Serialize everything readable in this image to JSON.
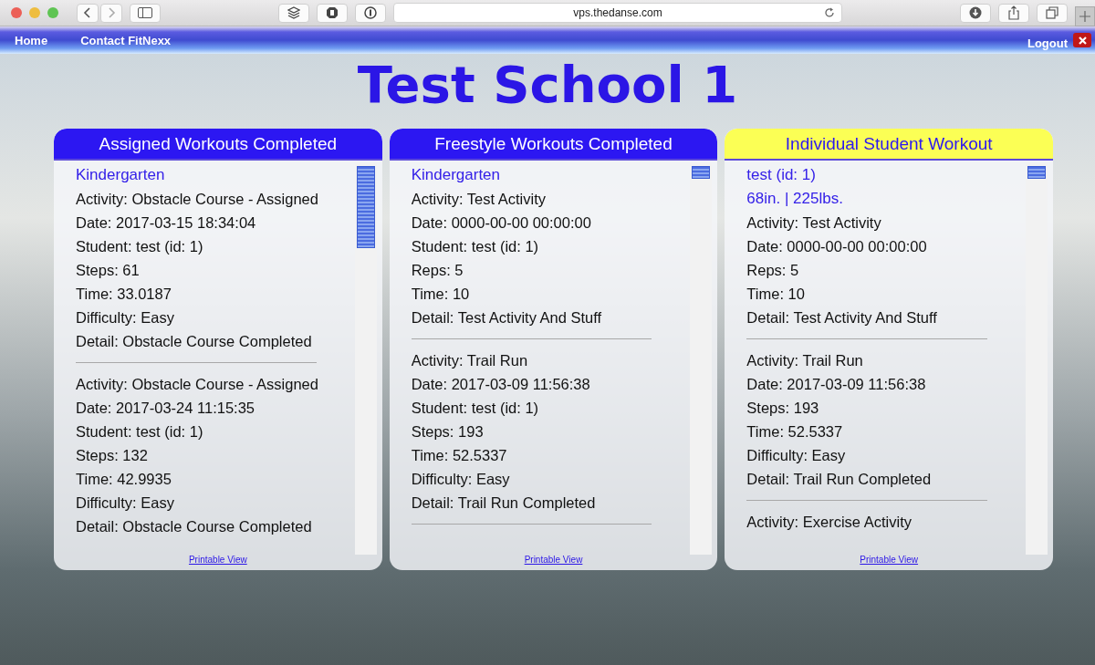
{
  "browser": {
    "url": "vps.thedanse.com"
  },
  "nav": {
    "links": [
      "Home",
      "Contact FitNexx"
    ],
    "logout": "Logout"
  },
  "title": "Test School 1",
  "panels": [
    {
      "title": "Assigned Workouts Completed",
      "kind": "primary",
      "headings": [
        "Kindergarten"
      ],
      "entries": [
        {
          "lines": [
            "Activity: Obstacle Course - Assigned",
            "Date: 2017-03-15 18:34:04",
            "Student: test (id: 1)",
            "Steps: 61",
            "Time: 33.0187",
            "Difficulty: Easy",
            "Detail: Obstacle Course Completed"
          ],
          "divider": true
        },
        {
          "lines": [
            "Activity: Obstacle Course - Assigned",
            "Date: 2017-03-24 11:15:35",
            "Student: test (id: 1)",
            "Steps: 132",
            "Time: 42.9935",
            "Difficulty: Easy",
            "Detail: Obstacle Course Completed"
          ],
          "divider": false
        }
      ],
      "link": "Printable View"
    },
    {
      "title": "Freestyle Workouts Completed",
      "kind": "primary",
      "headings": [
        "Kindergarten"
      ],
      "entries": [
        {
          "lines": [
            "Activity: Test Activity",
            "Date: 0000-00-00 00:00:00",
            "Student: test (id: 1)",
            "Reps: 5",
            "Time: 10",
            "Detail: Test Activity And Stuff"
          ],
          "divider": true
        },
        {
          "lines": [
            "Activity: Trail Run",
            "Date: 2017-03-09 11:56:38",
            "Student: test (id: 1)",
            "Steps: 193",
            "Time: 52.5337",
            "Difficulty: Easy",
            "Detail: Trail Run Completed"
          ],
          "divider": true
        }
      ],
      "link": "Printable View"
    },
    {
      "title": "Individual Student Workout",
      "kind": "highlight",
      "headings": [
        "test (id: 1)",
        "68in. | 225lbs."
      ],
      "entries": [
        {
          "lines": [
            "Activity: Test Activity",
            "Date: 0000-00-00 00:00:00",
            "Reps: 5",
            "Time: 10",
            "Detail: Test Activity And Stuff"
          ],
          "divider": true
        },
        {
          "lines": [
            "Activity: Trail Run",
            "Date: 2017-03-09 11:56:38",
            "Steps: 193",
            "Time: 52.5337",
            "Difficulty: Easy",
            "Detail: Trail Run Completed"
          ],
          "divider": true
        },
        {
          "lines": [
            "Activity: Exercise Activity"
          ],
          "divider": false
        }
      ],
      "link": "Printable View"
    }
  ]
}
